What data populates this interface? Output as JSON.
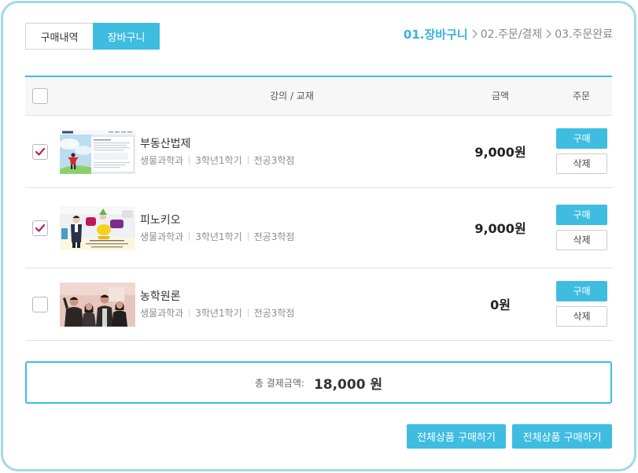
{
  "tabs": [
    {
      "label": "구매내역",
      "active": false
    },
    {
      "label": "장바구니",
      "active": true
    }
  ],
  "steps": [
    {
      "label": "01.장바구니",
      "active": true
    },
    {
      "label": "02.주문/결제",
      "active": false
    },
    {
      "label": "03.주문완료",
      "active": false
    }
  ],
  "cart": {
    "select_all_checked": false,
    "headers": {
      "course": "강의 / 교재",
      "price": "금액",
      "order": "주문"
    },
    "rows": [
      {
        "checked": true,
        "title": "부동산법제",
        "department": "생물과학과",
        "term": "3학년1학기",
        "credit": "전공3학점",
        "price": "9,000원",
        "buy_label": "구매",
        "delete_label": "삭제"
      },
      {
        "checked": true,
        "title": "피노키오",
        "department": "생물과학과",
        "term": "3학년1학기",
        "credit": "전공3학점",
        "price": "9,000원",
        "buy_label": "구매",
        "delete_label": "삭제"
      },
      {
        "checked": false,
        "title": "농학원론",
        "department": "생물과학과",
        "term": "3학년1학기",
        "credit": "전공3학점",
        "price": "0원",
        "buy_label": "구매",
        "delete_label": "삭제"
      }
    ]
  },
  "total": {
    "label": "총 결제금액:",
    "amount": "18,000 원"
  },
  "footer_buttons": [
    {
      "label": "전체상품 구매하기"
    },
    {
      "label": "전체상품 구매하기"
    }
  ],
  "icons": {
    "step_separator": "chevron-right-icon",
    "checkbox_mark": "check-icon"
  },
  "colors": {
    "accent": "#3fbde0",
    "frame": "#a2d8ea",
    "check": "#b2235e",
    "step_active": "#36b3dc"
  }
}
